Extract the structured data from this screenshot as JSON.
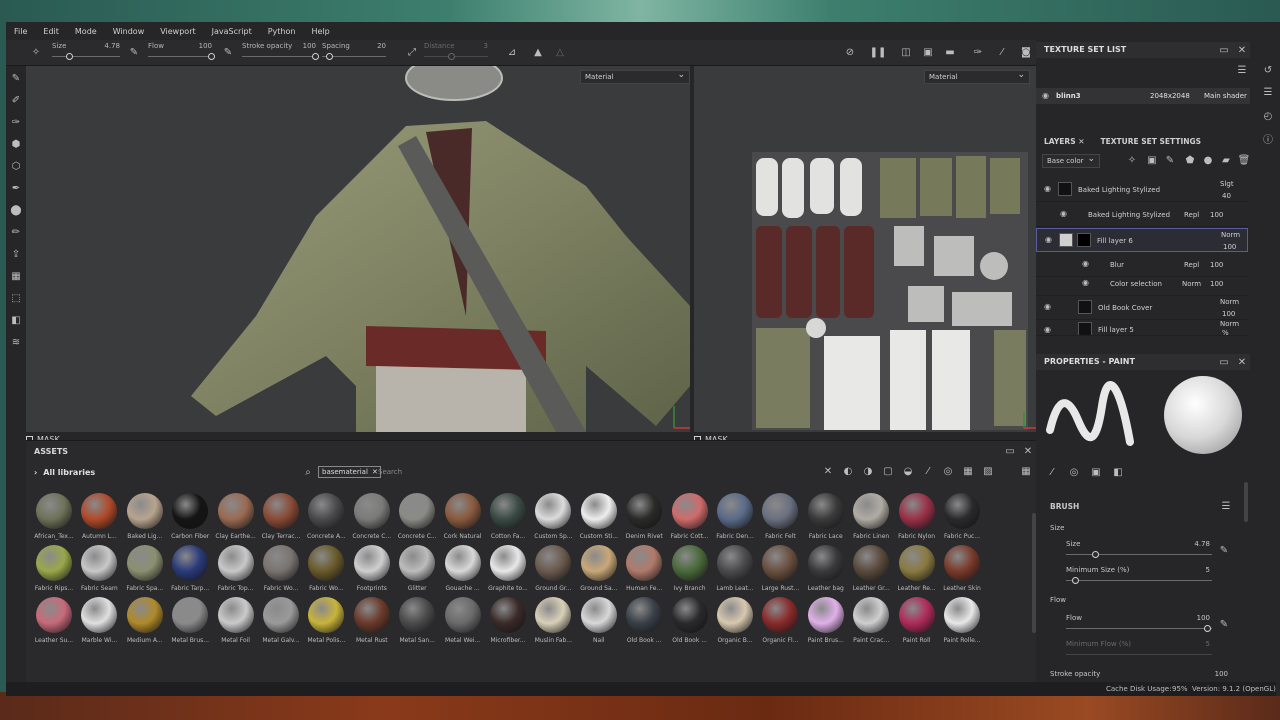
{
  "menu": [
    "File",
    "Edit",
    "Mode",
    "Window",
    "Viewport",
    "JavaScript",
    "Python",
    "Help"
  ],
  "tool_options": {
    "size_label": "Size",
    "size_value": "4.78",
    "flow_label": "Flow",
    "flow_value": "100",
    "stroke_opacity_label": "Stroke opacity",
    "stroke_opacity_value": "100",
    "spacing_label": "Spacing",
    "spacing_value": "20",
    "distance_label": "Distance",
    "distance_value": "3"
  },
  "viewport": {
    "material_dropdown_1": "Material",
    "material_dropdown_2": "Material",
    "mask_label": "MASK"
  },
  "texture_set_list": {
    "title": "TEXTURE SET LIST",
    "name": "blinn3",
    "resolution": "2048x2048",
    "shader": "Main shader"
  },
  "layers": {
    "tab_layers": "LAYERS",
    "tab_settings": "TEXTURE SET SETTINGS",
    "channel": "Base color",
    "rows": [
      {
        "name": "Baked Lighting Stylized",
        "blend": "Slgt",
        "opacity": "40"
      },
      {
        "name": "Baked Lighting Stylized",
        "blend": "Repl",
        "opacity": "100"
      },
      {
        "name": "Fill layer 6",
        "blend": "Norm",
        "opacity": "100"
      },
      {
        "name": "Blur",
        "blend": "Repl",
        "opacity": "100"
      },
      {
        "name": "Color selection",
        "blend": "Norm",
        "opacity": "100"
      },
      {
        "name": "Old Book Cover",
        "blend": "Norm",
        "opacity": "100"
      },
      {
        "name": "Fill layer 5",
        "blend": "Norm",
        "opacity": "%"
      }
    ]
  },
  "properties": {
    "title": "PROPERTIES - PAINT",
    "brush_title": "BRUSH",
    "size_section": "Size",
    "size_label": "Size",
    "size_value": "4.78",
    "min_size_label": "Minimum Size (%)",
    "min_size_value": "5",
    "flow_section": "Flow",
    "flow_label": "Flow",
    "flow_value": "100",
    "min_flow_label": "Minimum Flow (%)",
    "min_flow_value": "5",
    "stroke_opacity_label": "Stroke opacity",
    "stroke_opacity_value": "100"
  },
  "assets": {
    "title": "ASSETS",
    "libraries": "All libraries",
    "search_chip": "basematerial",
    "search_placeholder": "Search",
    "items": [
      {
        "label": "African_Tex...",
        "color": "#6e7258"
      },
      {
        "label": "Autumn L...",
        "color": "#b04a2a"
      },
      {
        "label": "Baked Lig...",
        "color": "#b8a48e"
      },
      {
        "label": "Carbon Fiber",
        "color": "#151515"
      },
      {
        "label": "Clay Earthe...",
        "color": "#9a6a52"
      },
      {
        "label": "Clay Terrac...",
        "color": "#8a4a36"
      },
      {
        "label": "Concrete A...",
        "color": "#4a4a4c"
      },
      {
        "label": "Concrete C...",
        "color": "#7a7a78"
      },
      {
        "label": "Concrete C...",
        "color": "#8a8a86"
      },
      {
        "label": "Cork Natural",
        "color": "#8a5a3e"
      },
      {
        "label": "Cotton Fa...",
        "color": "#3a4a44"
      },
      {
        "label": "Custom Sp...",
        "color": "#dcdcdc"
      },
      {
        "label": "Custom Sti...",
        "color": "#eeeeee"
      },
      {
        "label": "Denim Rivet",
        "color": "#2a2a28"
      },
      {
        "label": "Fabric Cott...",
        "color": "#d06a6a"
      },
      {
        "label": "Fabric Den...",
        "color": "#5a6a88"
      },
      {
        "label": "Fabric Felt",
        "color": "#6a7080"
      },
      {
        "label": "Fabric Lace",
        "color": "#3a3a3a"
      },
      {
        "label": "Fabric Linen",
        "color": "#b0aca4"
      },
      {
        "label": "Fabric Nylon",
        "color": "#9a3048"
      },
      {
        "label": "Fabric Puc...",
        "color": "#2a2a2c"
      },
      {
        "label": "Fabric Rips...",
        "color": "#9aa84a"
      },
      {
        "label": "Fabric Seam",
        "color": "#c8c8c8"
      },
      {
        "label": "Fabric Spa...",
        "color": "#8a9070"
      },
      {
        "label": "Fabric Tarp...",
        "color": "#2a3a7a"
      },
      {
        "label": "Fabric Top...",
        "color": "#c8c8c8"
      },
      {
        "label": "Fabric Wo...",
        "color": "#7a7470"
      },
      {
        "label": "Fabric Wo...",
        "color": "#6a5a2a"
      },
      {
        "label": "Footprints",
        "color": "#cfcfcf"
      },
      {
        "label": "Glitter",
        "color": "#bcbcbc"
      },
      {
        "label": "Gouache ...",
        "color": "#d8d8d8"
      },
      {
        "label": "Graphite to...",
        "color": "#e8e8e8"
      },
      {
        "label": "Ground Gr...",
        "color": "#6a5a4e"
      },
      {
        "label": "Ground Sa...",
        "color": "#c8a878"
      },
      {
        "label": "Human Fe...",
        "color": "#b07a6a"
      },
      {
        "label": "Ivy Branch",
        "color": "#4a6a3a"
      },
      {
        "label": "Lamb Leat...",
        "color": "#4a4a4c"
      },
      {
        "label": "Large Rust...",
        "color": "#6a5040"
      },
      {
        "label": "Leather bag",
        "color": "#3a3a3c"
      },
      {
        "label": "Leather Gr...",
        "color": "#5a4a3c"
      },
      {
        "label": "Leather Re...",
        "color": "#8a7a40"
      },
      {
        "label": "Leather Skin",
        "color": "#7a3a2a"
      },
      {
        "label": "Leather Su...",
        "color": "#c86a7a"
      },
      {
        "label": "Marble Wi...",
        "color": "#e0e0e0"
      },
      {
        "label": "Medium A...",
        "color": "#b08a2a"
      },
      {
        "label": "Metal Brus...",
        "color": "#8a8a8a"
      },
      {
        "label": "Metal Foil",
        "color": "#cacaca"
      },
      {
        "label": "Metal Galv...",
        "color": "#9a9a9a"
      },
      {
        "label": "Metal Polis...",
        "color": "#c8b43a"
      },
      {
        "label": "Metal Rust",
        "color": "#6a3a2a"
      },
      {
        "label": "Metal San...",
        "color": "#4a4a4a"
      },
      {
        "label": "Metal Wei...",
        "color": "#6a6a6a"
      },
      {
        "label": "Microfiber...",
        "color": "#3a2a28"
      },
      {
        "label": "Muslin Fab...",
        "color": "#d8d0b8"
      },
      {
        "label": "Nail",
        "color": "#d8d8d8"
      },
      {
        "label": "Old Book ...",
        "color": "#3a4048"
      },
      {
        "label": "Old Book ...",
        "color": "#2a2a2c"
      },
      {
        "label": "Organic B...",
        "color": "#d8c8b0"
      },
      {
        "label": "Organic Fl...",
        "color": "#8a2a2a"
      },
      {
        "label": "Paint Brus...",
        "color": "#e0b0e8"
      },
      {
        "label": "Paint Crac...",
        "color": "#cfcfcf"
      },
      {
        "label": "Paint Roll",
        "color": "#b02a5a"
      },
      {
        "label": "Paint Rolle...",
        "color": "#e8e8e8"
      }
    ]
  },
  "status": {
    "cache": "Cache Disk Usage:",
    "cache_value": "95%",
    "version": "Version: 9.1.2 (OpenGL)"
  }
}
